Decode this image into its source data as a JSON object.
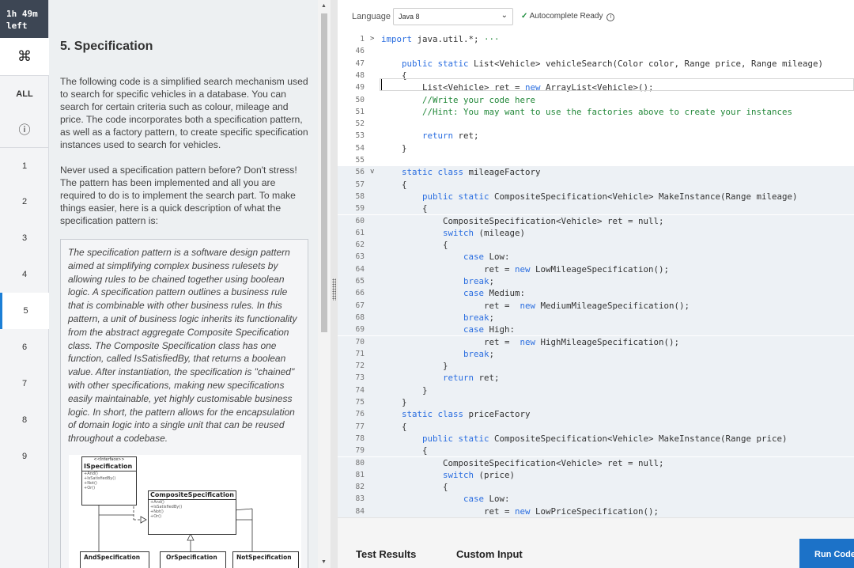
{
  "timer": {
    "line1": "1h 49m",
    "line2": "left"
  },
  "nav": {
    "cmd_icon": "⌘",
    "all_label": "ALL",
    "info_icon": "ⓘ",
    "questions": [
      "1",
      "2",
      "3",
      "4",
      "5",
      "6",
      "7",
      "8",
      "9"
    ],
    "active_question": "5"
  },
  "problem": {
    "title": "5. Specification",
    "para1": "The following code is a simplified search mechanism used to search for specific vehicles in a database. You can search for certain criteria such as colour, mileage and price. The code incorporates both a specification pattern, as well as a factory pattern, to create specific specification instances used to search for vehicles.",
    "para2": "Never used a specification pattern before? Don't stress! The pattern has been implemented and all you are required to do is to implement the search part. To make things easier, here is a quick description of what the specification pattern is:",
    "quote": "The specification pattern is a software design pattern aimed at simplifying complex business rulesets by allowing rules to be chained together using boolean logic. A specification pattern outlines a business rule that is combinable with other business rules. In this pattern, a unit of business logic inherits its functionality from the abstract aggregate Composite Specification class. The Composite Specification class has one function, called IsSatisfiedBy, that returns a boolean value. After instantiation, the specification is \"chained\" with other specifications, making new specifications easily maintainable, yet highly customisable business logic. In short, the pattern allows for the encapsulation of domain logic into a single unit that can be reused throughout a codebase.",
    "uml": {
      "interface_stereotype": "<<Interface>>",
      "interface_name": "ISpecification",
      "interface_ops": [
        "+And()",
        "+IsSatisfiedBy()",
        "+Not()",
        "+Or()"
      ],
      "composite_name": "CompositeSpecification",
      "composite_ops": [
        "+And()",
        "+IsSatisfiedBy()",
        "+Not()",
        "+Or()"
      ],
      "subclasses": [
        "AndSpecification",
        "OrSpecification",
        "NotSpecification"
      ]
    }
  },
  "editor": {
    "language_label": "Language",
    "language_value": "Java 8",
    "autocomplete_status": "Autocomplete Ready",
    "lines": [
      {
        "n": "1",
        "fold": ">",
        "hl": false,
        "segs": [
          {
            "t": "import",
            "c": "kw"
          },
          {
            "t": " java.util.*; ",
            "c": ""
          },
          {
            "t": "···",
            "c": "cm"
          }
        ]
      },
      {
        "n": "46",
        "fold": "",
        "hl": false,
        "segs": []
      },
      {
        "n": "47",
        "fold": "",
        "hl": false,
        "segs": [
          {
            "t": "    ",
            "c": ""
          },
          {
            "t": "public static",
            "c": "kw"
          },
          {
            "t": " List<Vehicle> vehicleSearch(Color color, Range price, Range mileage)",
            "c": ""
          }
        ]
      },
      {
        "n": "48",
        "fold": "",
        "hl": false,
        "segs": [
          {
            "t": "    {",
            "c": ""
          }
        ]
      },
      {
        "n": "49",
        "fold": "",
        "hl": false,
        "segs": [
          {
            "t": "        List<Vehicle> ret = ",
            "c": ""
          },
          {
            "t": "new",
            "c": "kw"
          },
          {
            "t": " ArrayList<Vehicle>();",
            "c": ""
          }
        ]
      },
      {
        "n": "50",
        "fold": "",
        "hl": false,
        "segs": [
          {
            "t": "        ",
            "c": ""
          },
          {
            "t": "//Write your code here",
            "c": "cm"
          }
        ]
      },
      {
        "n": "51",
        "fold": "",
        "hl": false,
        "segs": [
          {
            "t": "        ",
            "c": ""
          },
          {
            "t": "//Hint: You may want to use the factories above to create your instances",
            "c": "cm"
          }
        ]
      },
      {
        "n": "52",
        "fold": "",
        "hl": false,
        "segs": []
      },
      {
        "n": "53",
        "fold": "",
        "hl": false,
        "segs": [
          {
            "t": "        ",
            "c": ""
          },
          {
            "t": "return",
            "c": "kw"
          },
          {
            "t": " ret;",
            "c": ""
          }
        ]
      },
      {
        "n": "54",
        "fold": "",
        "hl": false,
        "segs": [
          {
            "t": "    }",
            "c": ""
          }
        ]
      },
      {
        "n": "55",
        "fold": "",
        "hl": false,
        "segs": []
      },
      {
        "n": "56",
        "fold": "v",
        "hl": true,
        "segs": [
          {
            "t": "    ",
            "c": ""
          },
          {
            "t": "static class",
            "c": "kw"
          },
          {
            "t": " mileageFactory",
            "c": ""
          }
        ]
      },
      {
        "n": "57",
        "fold": "",
        "hl": true,
        "segs": [
          {
            "t": "    {",
            "c": ""
          }
        ]
      },
      {
        "n": "58",
        "fold": "",
        "hl": true,
        "segs": [
          {
            "t": "        ",
            "c": ""
          },
          {
            "t": "public static",
            "c": "kw"
          },
          {
            "t": " CompositeSpecification<Vehicle> MakeInstance(Range mileage)",
            "c": ""
          }
        ]
      },
      {
        "n": "59",
        "fold": "",
        "hl": true,
        "segs": [
          {
            "t": "        {",
            "c": ""
          }
        ]
      },
      {
        "n": "60",
        "fold": "",
        "hl": true,
        "segs": [
          {
            "t": "            CompositeSpecification<Vehicle> ret = null;",
            "c": ""
          }
        ]
      },
      {
        "n": "61",
        "fold": "",
        "hl": true,
        "segs": [
          {
            "t": "            ",
            "c": ""
          },
          {
            "t": "switch",
            "c": "kw"
          },
          {
            "t": " (mileage)",
            "c": ""
          }
        ]
      },
      {
        "n": "62",
        "fold": "",
        "hl": true,
        "segs": [
          {
            "t": "            {",
            "c": ""
          }
        ]
      },
      {
        "n": "63",
        "fold": "",
        "hl": true,
        "segs": [
          {
            "t": "                ",
            "c": ""
          },
          {
            "t": "case",
            "c": "kw"
          },
          {
            "t": " Low:",
            "c": ""
          }
        ]
      },
      {
        "n": "64",
        "fold": "",
        "hl": true,
        "segs": [
          {
            "t": "                    ret = ",
            "c": ""
          },
          {
            "t": "new",
            "c": "kw"
          },
          {
            "t": " LowMileageSpecification();",
            "c": ""
          }
        ]
      },
      {
        "n": "65",
        "fold": "",
        "hl": true,
        "segs": [
          {
            "t": "                ",
            "c": ""
          },
          {
            "t": "break",
            "c": "kw"
          },
          {
            "t": ";",
            "c": ""
          }
        ]
      },
      {
        "n": "66",
        "fold": "",
        "hl": true,
        "segs": [
          {
            "t": "                ",
            "c": ""
          },
          {
            "t": "case",
            "c": "kw"
          },
          {
            "t": " Medium:",
            "c": ""
          }
        ]
      },
      {
        "n": "67",
        "fold": "",
        "hl": true,
        "segs": [
          {
            "t": "                    ret =  ",
            "c": ""
          },
          {
            "t": "new",
            "c": "kw"
          },
          {
            "t": " MediumMileageSpecification();",
            "c": ""
          }
        ]
      },
      {
        "n": "68",
        "fold": "",
        "hl": true,
        "segs": [
          {
            "t": "                ",
            "c": ""
          },
          {
            "t": "break",
            "c": "kw"
          },
          {
            "t": ";",
            "c": ""
          }
        ]
      },
      {
        "n": "69",
        "fold": "",
        "hl": true,
        "segs": [
          {
            "t": "                ",
            "c": ""
          },
          {
            "t": "case",
            "c": "kw"
          },
          {
            "t": " High:",
            "c": ""
          }
        ]
      },
      {
        "n": "70",
        "fold": "",
        "hl": true,
        "segs": [
          {
            "t": "                    ret =  ",
            "c": ""
          },
          {
            "t": "new",
            "c": "kw"
          },
          {
            "t": " HighMileageSpecification();",
            "c": ""
          }
        ]
      },
      {
        "n": "71",
        "fold": "",
        "hl": true,
        "segs": [
          {
            "t": "                ",
            "c": ""
          },
          {
            "t": "break",
            "c": "kw"
          },
          {
            "t": ";",
            "c": ""
          }
        ]
      },
      {
        "n": "72",
        "fold": "",
        "hl": true,
        "segs": [
          {
            "t": "            }",
            "c": ""
          }
        ]
      },
      {
        "n": "73",
        "fold": "",
        "hl": true,
        "segs": [
          {
            "t": "            ",
            "c": ""
          },
          {
            "t": "return",
            "c": "kw"
          },
          {
            "t": " ret;",
            "c": ""
          }
        ]
      },
      {
        "n": "74",
        "fold": "",
        "hl": true,
        "segs": [
          {
            "t": "        }",
            "c": ""
          }
        ]
      },
      {
        "n": "75",
        "fold": "",
        "hl": true,
        "segs": [
          {
            "t": "    }",
            "c": ""
          }
        ]
      },
      {
        "n": "76",
        "fold": "",
        "hl": true,
        "segs": [
          {
            "t": "    ",
            "c": ""
          },
          {
            "t": "static class",
            "c": "kw"
          },
          {
            "t": " priceFactory",
            "c": ""
          }
        ]
      },
      {
        "n": "77",
        "fold": "",
        "hl": true,
        "segs": [
          {
            "t": "    {",
            "c": ""
          }
        ]
      },
      {
        "n": "78",
        "fold": "",
        "hl": true,
        "segs": [
          {
            "t": "        ",
            "c": ""
          },
          {
            "t": "public static",
            "c": "kw"
          },
          {
            "t": " CompositeSpecification<Vehicle> MakeInstance(Range price)",
            "c": ""
          }
        ]
      },
      {
        "n": "79",
        "fold": "",
        "hl": true,
        "segs": [
          {
            "t": "        {",
            "c": ""
          }
        ]
      },
      {
        "n": "80",
        "fold": "",
        "hl": true,
        "segs": [
          {
            "t": "            CompositeSpecification<Vehicle> ret = null;",
            "c": ""
          }
        ]
      },
      {
        "n": "81",
        "fold": "",
        "hl": true,
        "segs": [
          {
            "t": "            ",
            "c": ""
          },
          {
            "t": "switch",
            "c": "kw"
          },
          {
            "t": " (price)",
            "c": ""
          }
        ]
      },
      {
        "n": "82",
        "fold": "",
        "hl": true,
        "segs": [
          {
            "t": "            {",
            "c": ""
          }
        ]
      },
      {
        "n": "83",
        "fold": "",
        "hl": true,
        "segs": [
          {
            "t": "                ",
            "c": ""
          },
          {
            "t": "case",
            "c": "kw"
          },
          {
            "t": " Low:",
            "c": ""
          }
        ]
      },
      {
        "n": "84",
        "fold": "",
        "hl": true,
        "segs": [
          {
            "t": "                    ret = ",
            "c": ""
          },
          {
            "t": "new",
            "c": "kw"
          },
          {
            "t": " LowPriceSpecification();",
            "c": ""
          }
        ]
      }
    ]
  },
  "bottom": {
    "test_results": "Test Results",
    "custom_input": "Custom Input",
    "run_code": "Run Code"
  },
  "colors": {
    "accent": "#1c72c8",
    "keyword": "#2b6ee0",
    "comment": "#23883a",
    "timer_bg": "#3d4654"
  }
}
